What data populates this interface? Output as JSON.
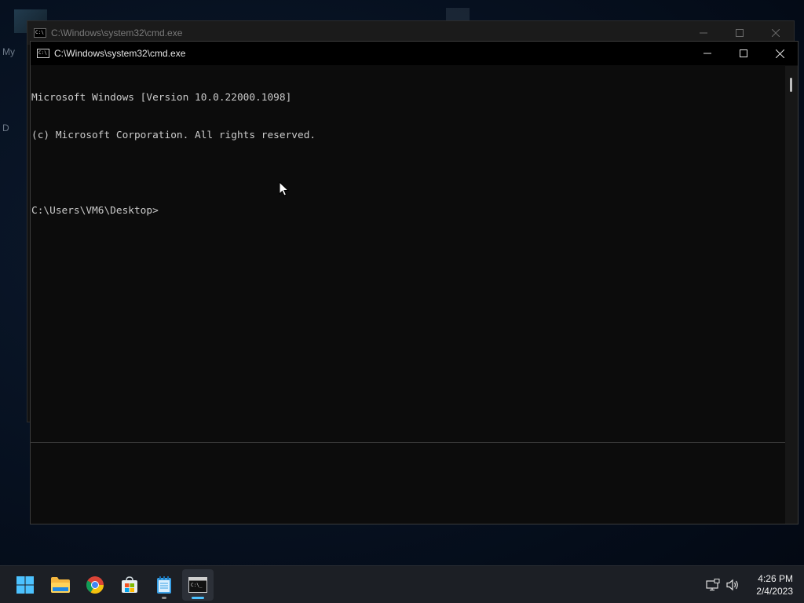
{
  "desktop": {
    "fragment_my": "My",
    "fragment_d": "D"
  },
  "background_window": {
    "title": "C:\\Windows\\system32\\cmd.exe"
  },
  "front_window": {
    "title": "C:\\Windows\\system32\\cmd.exe",
    "console_lines": [
      "Microsoft Windows [Version 10.0.22000.1098]",
      "(c) Microsoft Corporation. All rights reserved.",
      "",
      "C:\\Users\\VM6\\Desktop>"
    ]
  },
  "taskbar": {
    "items": [
      {
        "name": "start",
        "icon": "windows-logo-icon"
      },
      {
        "name": "file-explorer",
        "icon": "folder-icon"
      },
      {
        "name": "chrome",
        "icon": "chrome-icon"
      },
      {
        "name": "microsoft-store",
        "icon": "store-icon"
      },
      {
        "name": "notepad",
        "icon": "notepad-icon"
      },
      {
        "name": "command-prompt",
        "icon": "cmd-icon"
      }
    ],
    "clock_time": "4:26 PM",
    "clock_date": "2/4/2023"
  },
  "colors": {
    "accent": "#4cc2ff",
    "console_text": "#cccccc",
    "console_bg": "#0c0c0c"
  }
}
